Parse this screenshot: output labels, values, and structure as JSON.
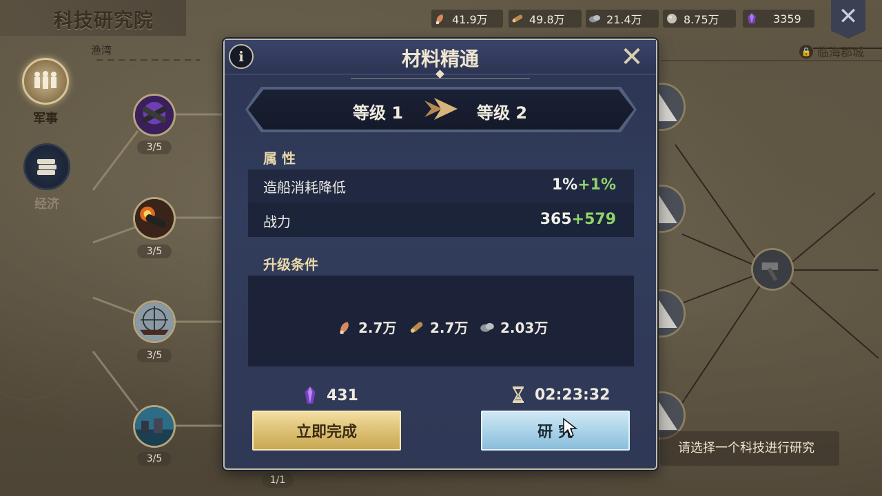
{
  "page": {
    "title": "科技研究院",
    "region_label": "临海郡城",
    "bay_label": "渔湾",
    "hint": "请选择一个科技进行研究"
  },
  "resources": [
    {
      "icon": "meat-icon",
      "value": "41.9万",
      "color": "#d88a5c"
    },
    {
      "icon": "wood-icon",
      "value": "49.8万",
      "color": "#b98a4c"
    },
    {
      "icon": "ore-icon",
      "value": "21.4万",
      "color": "#9aa0a6"
    },
    {
      "icon": "stone-icon",
      "value": "8.75万",
      "color": "#c7c3bb"
    },
    {
      "icon": "gem-icon",
      "value": "3359",
      "color": "#7a3fc2"
    }
  ],
  "categories": [
    {
      "label": "军事",
      "active": true
    },
    {
      "label": "经济",
      "active": false
    }
  ],
  "nodes": [
    {
      "count": "3/5"
    },
    {
      "count": "3/5"
    },
    {
      "count": "3/5"
    },
    {
      "count": "3/5"
    }
  ],
  "bottom_count": "1/1",
  "modal": {
    "title": "材料精通",
    "info_label": "i",
    "level_from": "等级 1",
    "level_to": "等级 2",
    "attributes_title": "属 性",
    "attributes": [
      {
        "name": "造船消耗降低",
        "base": "1%",
        "bonus": "+1%"
      },
      {
        "name": "战力",
        "base": "365",
        "bonus": "+579"
      }
    ],
    "conditions_title": "升级条件",
    "costs": [
      {
        "icon": "meat-icon",
        "value": "2.7万"
      },
      {
        "icon": "wood-icon",
        "value": "2.7万"
      },
      {
        "icon": "ore-icon",
        "value": "2.03万"
      }
    ],
    "gem_cost": "431",
    "time_cost": "02:23:32",
    "finish_button": "立即完成",
    "research_button": "研 究"
  },
  "colors": {
    "modal_bg": "#2f3855",
    "bonus_green": "#8fd36a",
    "gold_button": "#d8bb6c",
    "blue_button": "#a4cfe6"
  }
}
